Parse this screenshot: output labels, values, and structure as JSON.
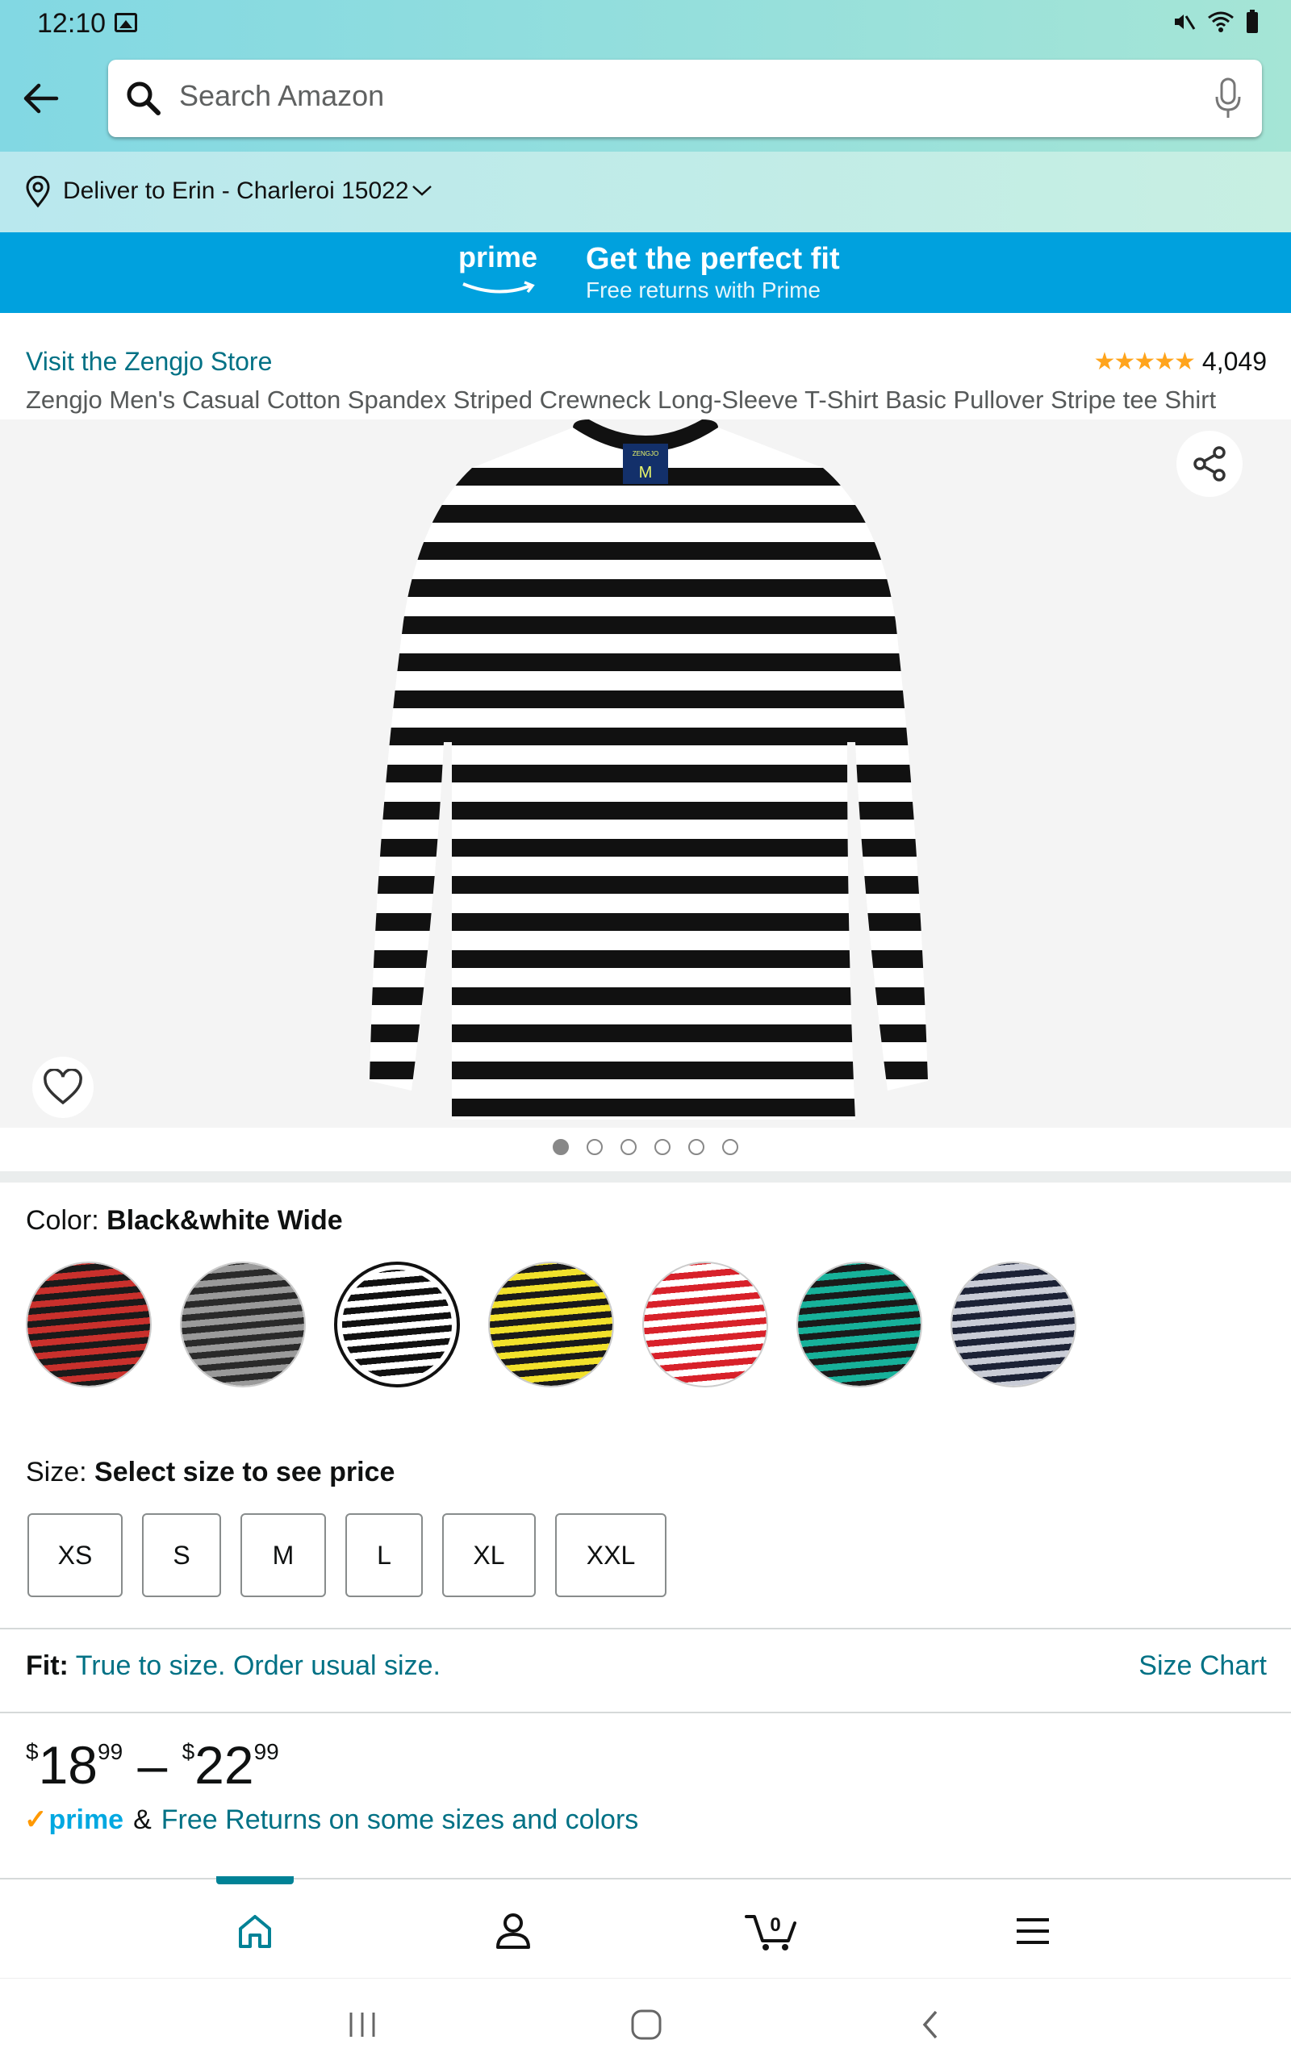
{
  "status": {
    "time": "12:10"
  },
  "search": {
    "placeholder": "Search Amazon"
  },
  "delivery": {
    "text": "Deliver to Erin - Charleroi 15022"
  },
  "prime_banner": {
    "logo": "prime",
    "headline": "Get the perfect fit",
    "subline": "Free returns with Prime"
  },
  "product": {
    "store_link": "Visit the Zengjo Store",
    "rating_stars": "★★★★★",
    "rating_value": 4.5,
    "rating_count": "4,049",
    "title": "Zengjo Men's Casual Cotton Spandex Striped Crewneck Long-Sleeve T-Shirt Basic Pullover Stripe tee Shirt",
    "image_count": 6,
    "image_index": 1,
    "shirt_tag_text": "ZENGJO",
    "shirt_tag_size": "M"
  },
  "color": {
    "label": "Color: ",
    "selected": "Black&white Wide",
    "swatches": [
      {
        "name": "red-black-stripe",
        "a": "#c9302c",
        "b": "#1a1a1a"
      },
      {
        "name": "black-grey-stripe",
        "a": "#2a2a2a",
        "b": "#9a9a9a"
      },
      {
        "name": "black-white-wide",
        "a": "#111111",
        "b": "#ffffff",
        "selected": true
      },
      {
        "name": "yellow-black-stripe",
        "a": "#f2e12b",
        "b": "#1a1a1a"
      },
      {
        "name": "red-white-stripe",
        "a": "#d8212a",
        "b": "#ffffff"
      },
      {
        "name": "green-black-stripe",
        "a": "#17b19a",
        "b": "#1a1a1a"
      },
      {
        "name": "navy-white-stripe",
        "a": "#1c2236",
        "b": "#c9ccd6"
      }
    ]
  },
  "size": {
    "label": "Size: ",
    "prompt": "Select size to see price",
    "options": [
      "XS",
      "S",
      "M",
      "L",
      "XL",
      "XXL"
    ]
  },
  "fit": {
    "label": "Fit:",
    "text": "True to size. Order usual size.",
    "size_chart": "Size Chart"
  },
  "price": {
    "currency": "$",
    "low_whole": "18",
    "low_frac": "99",
    "separator": "–",
    "high_whole": "22",
    "high_frac": "99"
  },
  "returns": {
    "prime": "prime",
    "amp": "&",
    "text": "Free Returns on some sizes and colors"
  },
  "nav": {
    "cart_count": "0"
  },
  "colors": {
    "teal_link": "#007185",
    "prime_blue": "#00a1de",
    "nav_active": "#008296",
    "star": "#ffa41c"
  }
}
